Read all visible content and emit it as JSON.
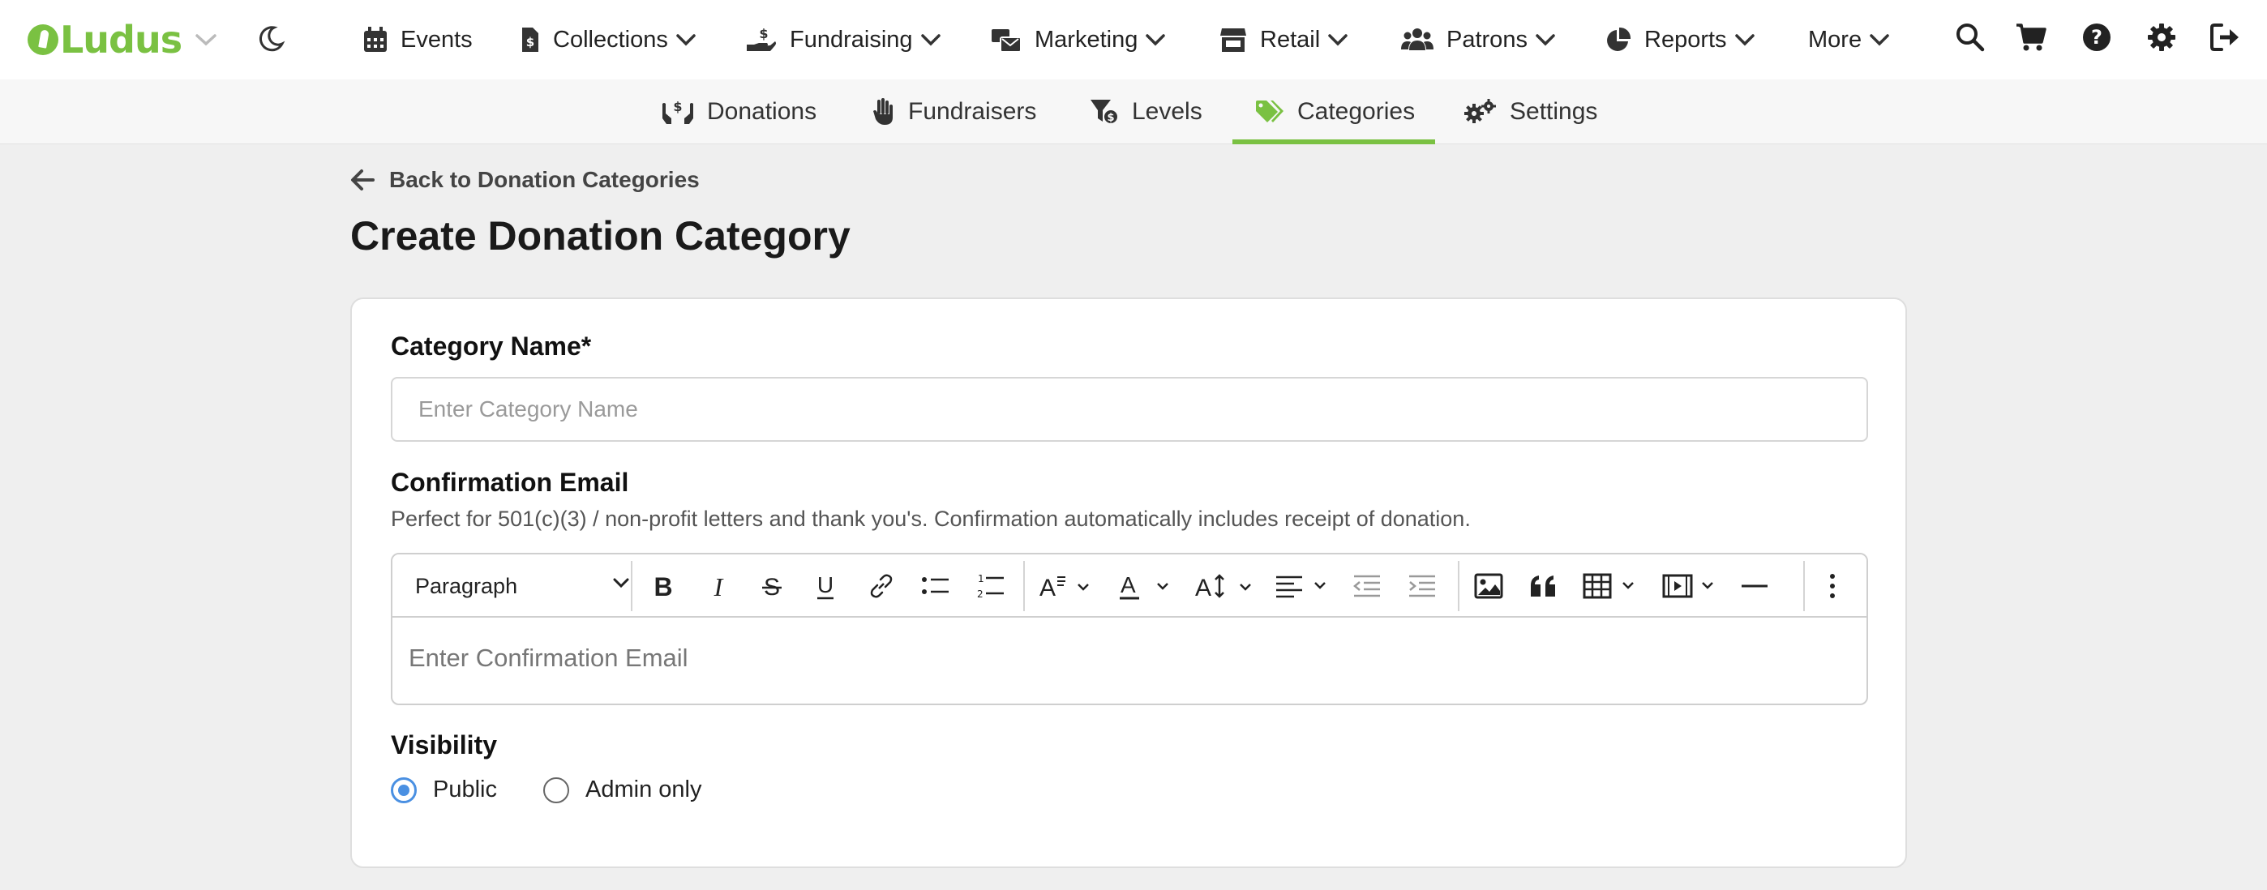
{
  "app": {
    "logo_text": "Ludus"
  },
  "nav": {
    "events": "Events",
    "collections": "Collections",
    "fundraising": "Fundraising",
    "marketing": "Marketing",
    "retail": "Retail",
    "patrons": "Patrons",
    "reports": "Reports",
    "more": "More"
  },
  "subnav": {
    "donations": "Donations",
    "fundraisers": "Fundraisers",
    "levels": "Levels",
    "categories": "Categories",
    "settings": "Settings",
    "active": "Categories"
  },
  "page": {
    "back_label": "Back to Donation Categories",
    "title": "Create Donation Category"
  },
  "form": {
    "category_name_label": "Category Name*",
    "category_name_placeholder": "Enter Category Name",
    "category_name_value": "",
    "confirmation_label": "Confirmation Email",
    "confirmation_hint": "Perfect for 501(c)(3) / non-profit letters and thank you's. Confirmation automatically includes receipt of donation.",
    "paragraph_select": "Paragraph",
    "confirmation_placeholder": "Enter Confirmation Email",
    "visibility_label": "Visibility",
    "visibility_options": [
      "Public",
      "Admin only"
    ],
    "visibility_selected": "Public"
  },
  "colors": {
    "brand": "#7ac142",
    "radio_selected": "#4a90e2"
  }
}
